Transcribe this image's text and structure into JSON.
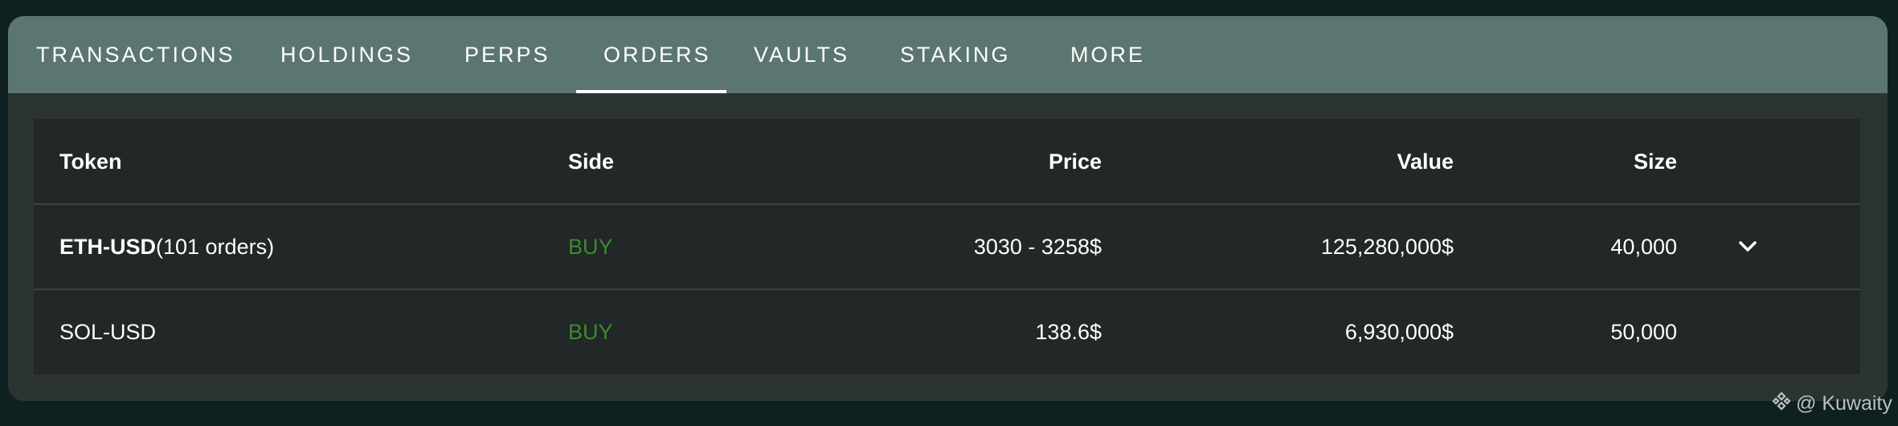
{
  "tabs": [
    {
      "label": "TRANSACTIONS"
    },
    {
      "label": "HOLDINGS"
    },
    {
      "label": "PERPS"
    },
    {
      "label": "ORDERS",
      "active": true
    },
    {
      "label": "VAULTS"
    },
    {
      "label": "STAKING"
    },
    {
      "label": "MORE"
    }
  ],
  "table": {
    "headers": [
      "Token",
      "Side",
      "Price",
      "Value",
      "Size"
    ],
    "rows": [
      {
        "token": "ETH-USD",
        "token_suffix": "(101 orders)",
        "side": "BUY",
        "price": "3030 - 3258$",
        "value": "125,280,000$",
        "size": "40,000",
        "expand_icon": "chevron-down-icon"
      },
      {
        "token": "SOL-USD",
        "token_suffix": "",
        "side": "BUY",
        "price": "138.6$",
        "value": "6,930,000$",
        "size": "50,000"
      }
    ]
  },
  "watermark": {
    "text": "@ Kuwaity"
  },
  "colors": {
    "background": "#0e2020",
    "panel": "#2c3432",
    "tabbar": "#5b7670",
    "table": "#222727",
    "buy": "#3e8a2e"
  }
}
